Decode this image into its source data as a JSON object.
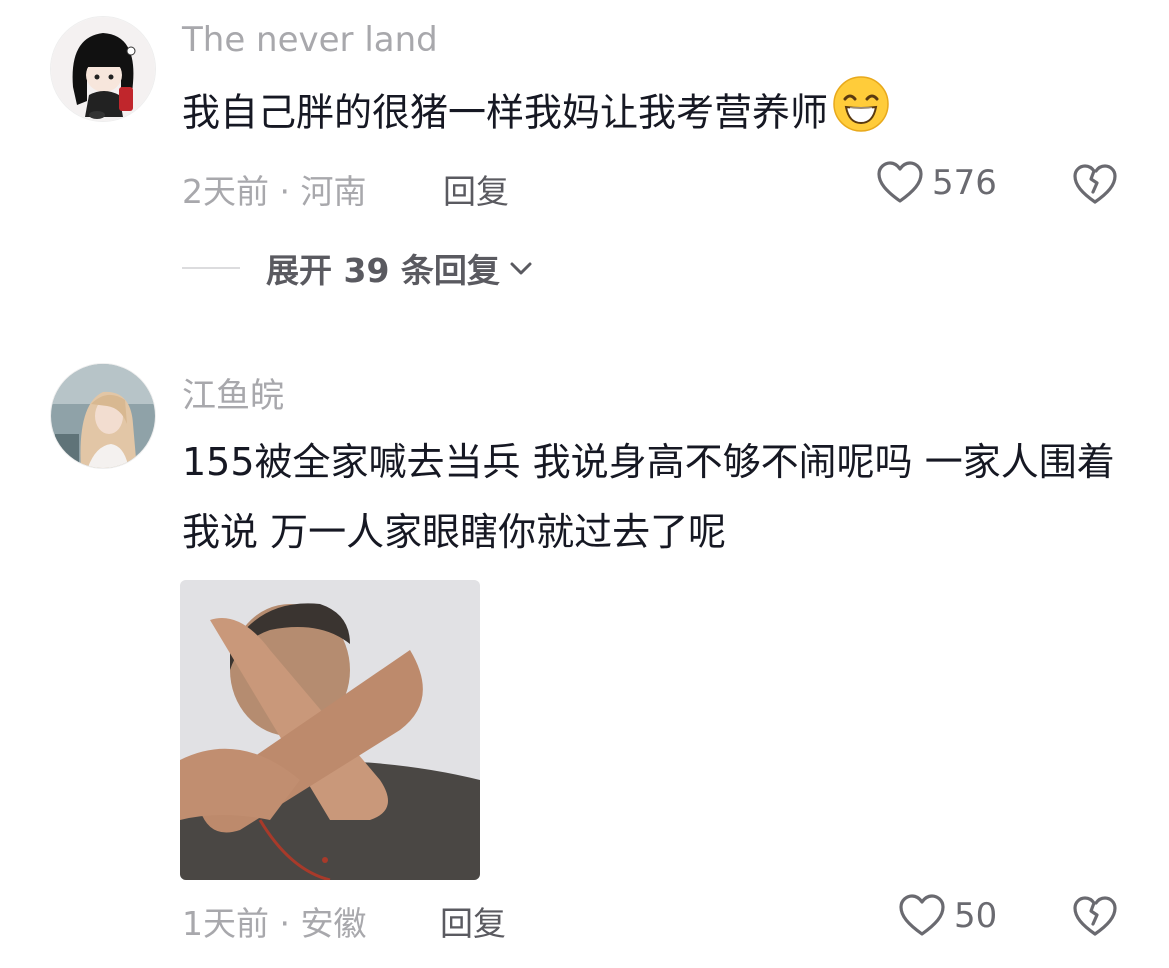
{
  "comments": [
    {
      "username": "The never land",
      "text": "我自己胖的很猪一样我妈让我考营养师",
      "emoji": "grinning-sweat-emoji",
      "time_location": "2天前 · 河南",
      "reply_label": "回复",
      "likes": "576",
      "expand_label": "展开 39 条回复"
    },
    {
      "username": "江鱼皖",
      "text": "155被全家喊去当兵 我说身高不够不闹呢吗 一家人围着我说 万一人家眼瞎你就过去了呢",
      "time_location": "1天前 · 安徽",
      "reply_label": "回复",
      "likes": "50"
    }
  ],
  "colors": {
    "secondary_text": "#a8a8ac",
    "primary_text": "#161823",
    "icon_gray": "#5a5a60"
  }
}
